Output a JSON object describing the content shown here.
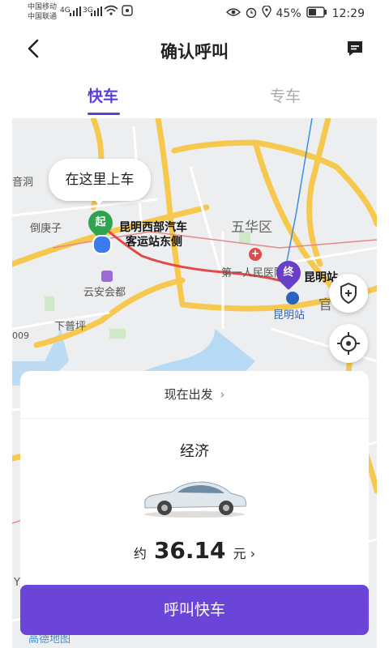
{
  "status_bar": {
    "carrier1": "中国移动",
    "carrier2": "中国联通",
    "net1": "4G",
    "net2": "3G",
    "battery": "45%",
    "time": "12:29"
  },
  "header": {
    "title": "确认呼叫"
  },
  "tabs": [
    {
      "label": "快车",
      "active": true
    },
    {
      "label": "专车",
      "active": false
    }
  ],
  "map": {
    "pickup_bubble": "在这里上车",
    "start_badge": "起",
    "end_badge": "终",
    "start_name_line1": "昆明西部汽车",
    "start_name_line2": "客运站东侧",
    "end_name": "昆明站",
    "labels": {
      "district": "五华区",
      "hospital": "第一人民医院",
      "area1": "倒庚子",
      "area2": "云安会都",
      "area3": "下普坪",
      "station": "昆明站",
      "left_edge": "音洞",
      "road_num": "009",
      "right_edge": "官",
      "bottom_left": "Y"
    },
    "provider": "高德地图",
    "accent_start": "#2ea44f",
    "accent_end": "#6a3fc8",
    "route_color": "#e04a4a"
  },
  "panel": {
    "depart": "现在出发",
    "category": "经济",
    "price_prefix": "约",
    "price": "36.14",
    "price_suffix": "元"
  },
  "call_button": "呼叫快车",
  "colors": {
    "accent": "#6a45d8"
  }
}
